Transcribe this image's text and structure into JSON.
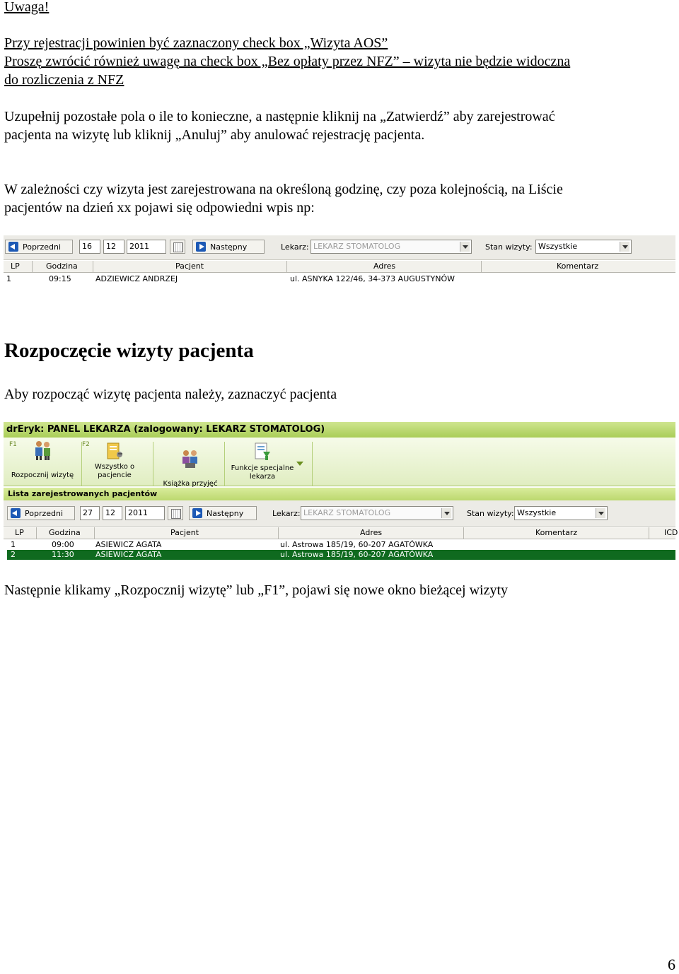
{
  "doc": {
    "uwaga": "Uwaga!",
    "line1": "Przy rejestracji powinien być zaznaczony check box „Wizyta AOS”",
    "line2": "Proszę zwrócić również uwagę na check box „Bez opłaty przez NFZ” – wizyta nie będzie widoczna",
    "line3": "do rozliczenia z NFZ",
    "para1_l1": "Uzupełnij pozostałe pola o ile to konieczne, a następnie kliknij na „Zatwierdź” aby zarejestrować",
    "para1_l2": "pacjenta na wizytę  lub kliknij „Anuluj” aby anulować rejestrację pacjenta.",
    "para2_l1": "W zależności czy wizyta jest zarejestrowana na określoną godzinę, czy poza kolejnością, na Liście",
    "para2_l2": "pacjentów na dzień xx pojawi się odpowiedni wpis np:",
    "heading": "Rozpoczęcie wizyty pacjenta",
    "para3": "Aby rozpocząć wizytę pacjenta należy, zaznaczyć pacjenta",
    "para4": "Następnie klikamy „Rozpocznij wizytę” lub „F1”, pojawi się nowe okno bieżącej wizyty",
    "page_number": "6"
  },
  "shot1": {
    "prev_label": "Poprzedni",
    "day": "16",
    "month": "12",
    "year": "2011",
    "next_label": "Następny",
    "doctor_label": "Lekarz:",
    "doctor_value": "LEKARZ STOMATOLOG",
    "status_label": "Stan wizyty:",
    "status_value": "Wszystkie",
    "columns": [
      "LP",
      "Godzina",
      "Pacjent",
      "Adres",
      "Komentarz"
    ],
    "rows": [
      {
        "lp": "1",
        "time": "09:15",
        "patient": "ADZIEWICZ ANDRZEJ",
        "address": "ul. ASNYKA 122/46, 34-373 AUGUSTYNÓW"
      }
    ]
  },
  "shot2": {
    "title": "drEryk: PANEL LEKARZA (zalogowany: LEKARZ STOMATOLOG)",
    "ribbon": [
      {
        "fkey": "F1",
        "l1": "",
        "l2": "Rozpocznij wizytę"
      },
      {
        "fkey": "F2",
        "l1": "Wszystko o",
        "l2": "pacjencie"
      },
      {
        "fkey": "",
        "l1": "",
        "l2": "Książka przyjęć"
      },
      {
        "fkey": "",
        "l1": "Funkcje specjalne",
        "l2": "lekarza"
      }
    ],
    "section": "Lista zarejestrowanych pacjentów",
    "prev_label": "Poprzedni",
    "day": "27",
    "month": "12",
    "year": "2011",
    "next_label": "Następny",
    "doctor_label": "Lekarz:",
    "doctor_value": "LEKARZ STOMATOLOG",
    "status_label": "Stan wizyty:",
    "status_value": "Wszystkie",
    "columns": [
      "LP",
      "Godzina",
      "Pacjent",
      "Adres",
      "Komentarz",
      "ICD"
    ],
    "rows": [
      {
        "lp": "1",
        "time": "09:00",
        "patient": "ASIEWICZ AGATA",
        "address": "ul. Astrowa 185/19, 60-207 AGATÓWKA"
      },
      {
        "lp": "2",
        "time": "11:30",
        "patient": "ASIEWICZ AGATA",
        "address": "ul. Astrowa 185/19, 60-207 AGATÓWKA"
      }
    ]
  },
  "colors": {
    "selected_row": "#0f6a1f",
    "title_bar": "#a9cd57",
    "nav_icon": "#1d59b5"
  }
}
